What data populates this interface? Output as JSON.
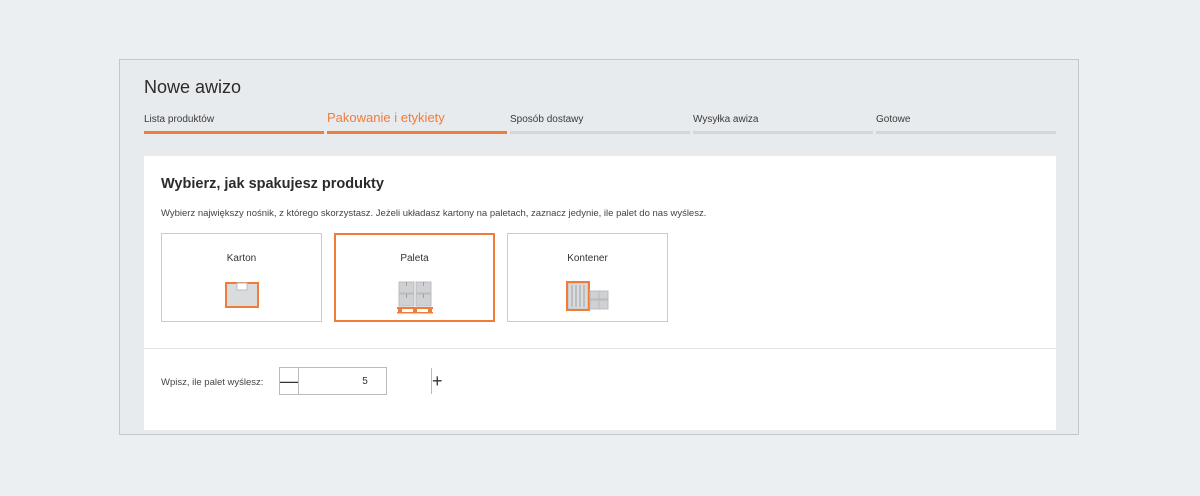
{
  "title": "Nowe awizo",
  "steps": [
    {
      "label": "Lista produktów",
      "state": "done"
    },
    {
      "label": "Pakowanie i etykiety",
      "state": "active"
    },
    {
      "label": "Sposób dostawy",
      "state": "pending"
    },
    {
      "label": "Wysyłka awiza",
      "state": "pending"
    },
    {
      "label": "Gotowe",
      "state": "pending"
    }
  ],
  "section": {
    "heading": "Wybierz, jak spakujesz produkty",
    "description": "Wybierz największy nośnik, z którego skorzystasz. Jeżeli układasz kartony na paletach, zaznacz jedynie, ile palet do nas wyślesz."
  },
  "options": [
    {
      "label": "Karton",
      "icon": "box-icon",
      "selected": false
    },
    {
      "label": "Paleta",
      "icon": "pallet-icon",
      "selected": true
    },
    {
      "label": "Kontener",
      "icon": "container-icon",
      "selected": false
    }
  ],
  "quantity": {
    "label": "Wpisz, ile palet wyślesz:",
    "value": "5",
    "minus_glyph": "—",
    "plus_glyph": "+"
  },
  "colors": {
    "accent": "#f07c3a",
    "icon_gray": "#b9bcbf",
    "background": "#eceff2"
  }
}
